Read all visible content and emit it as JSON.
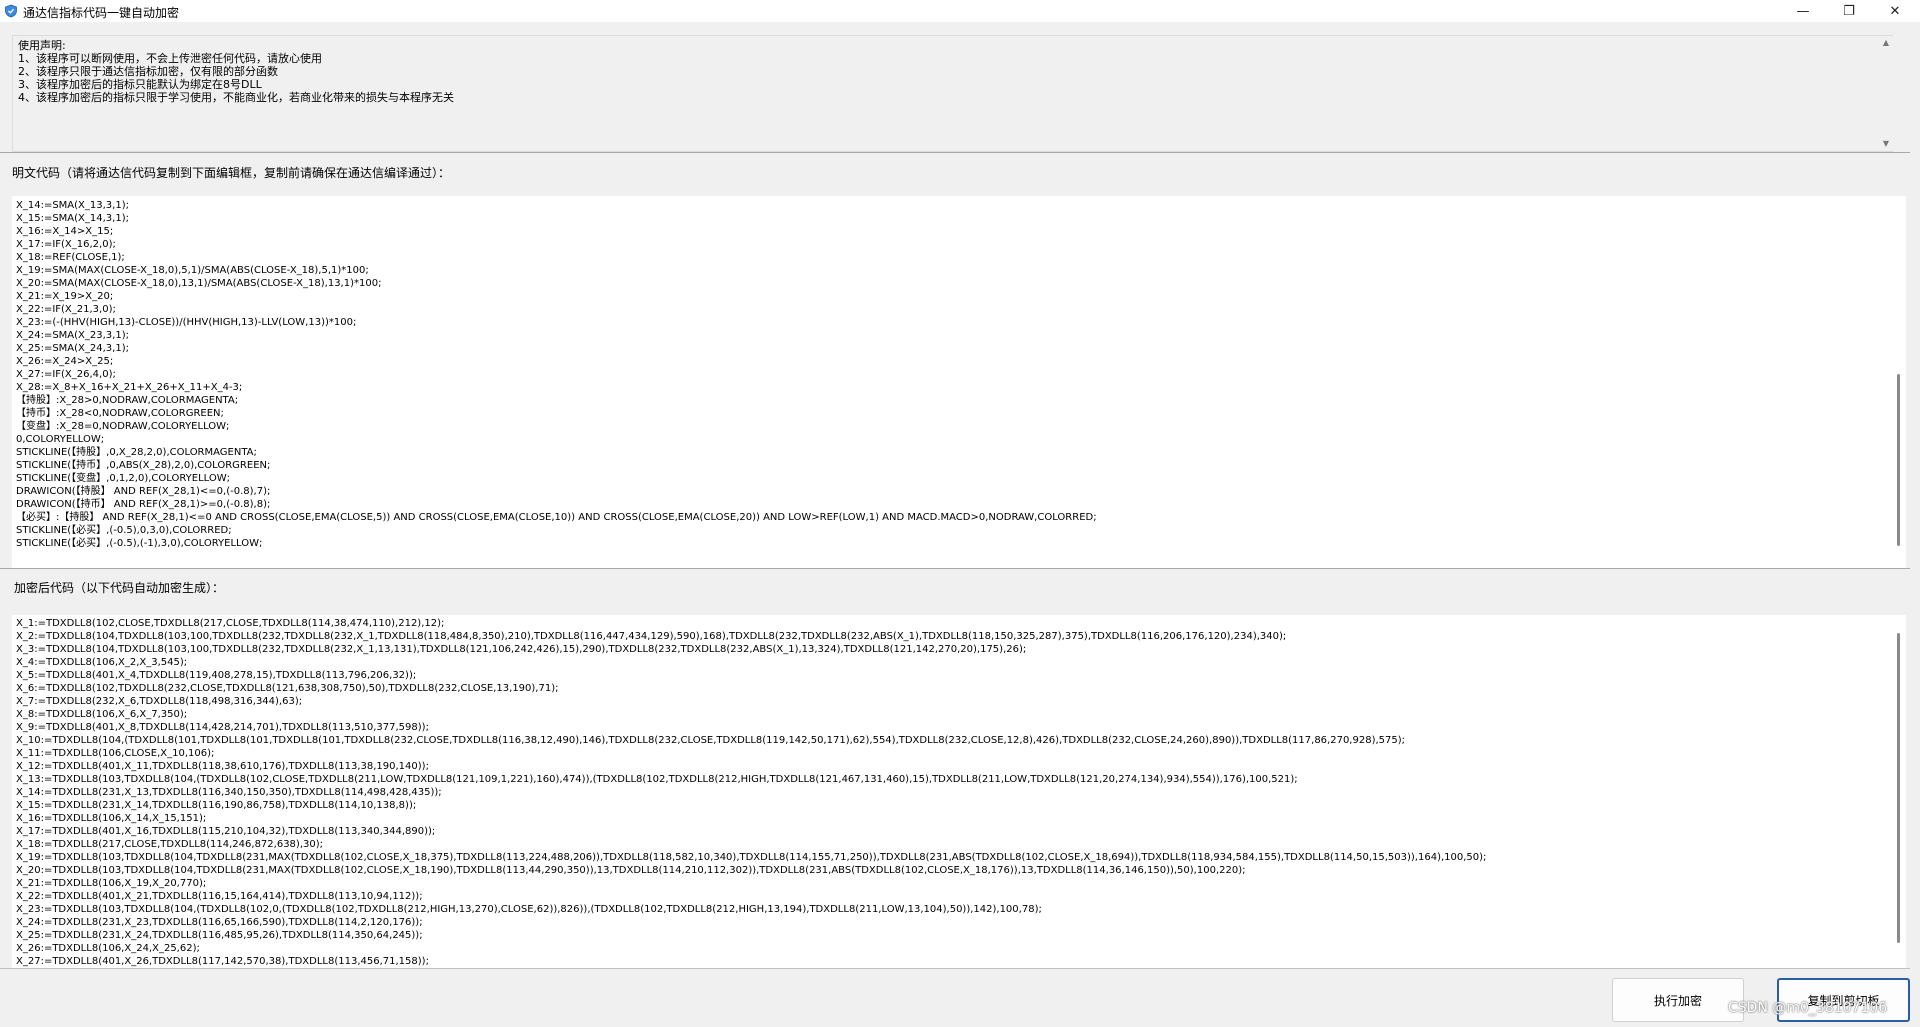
{
  "window": {
    "title": "通达信指标代码一键自动加密",
    "minimize_glyph": "—",
    "maximize_glyph": "❐",
    "close_glyph": "✕"
  },
  "disclaimer": {
    "lines": [
      "使用声明:",
      "1、该程序可以断网使用，不会上传泄密任何代码，请放心使用",
      "2、该程序只限于通达信指标加密，仅有限的部分函数",
      "3、该程序加密后的指标只能默认为绑定在8号DLL",
      "4、该程序加密后的指标只限于学习使用，不能商业化，若商业化带来的损失与本程序无关"
    ]
  },
  "plain_label": "明文代码（请将通达信代码复制到下面编辑框，复制前请确保在通达信编译通过）：",
  "plain_code": [
    "X_14:=SMA(X_13,3,1);",
    "X_15:=SMA(X_14,3,1);",
    "X_16:=X_14>X_15;",
    "X_17:=IF(X_16,2,0);",
    "X_18:=REF(CLOSE,1);",
    "X_19:=SMA(MAX(CLOSE-X_18,0),5,1)/SMA(ABS(CLOSE-X_18),5,1)*100;",
    "X_20:=SMA(MAX(CLOSE-X_18,0),13,1)/SMA(ABS(CLOSE-X_18),13,1)*100;",
    "X_21:=X_19>X_20;",
    "X_22:=IF(X_21,3,0);",
    "X_23:=(-(HHV(HIGH,13)-CLOSE))/(HHV(HIGH,13)-LLV(LOW,13))*100;",
    "X_24:=SMA(X_23,3,1);",
    "X_25:=SMA(X_24,3,1);",
    "X_26:=X_24>X_25;",
    "X_27:=IF(X_26,4,0);",
    "X_28:=X_8+X_16+X_21+X_26+X_11+X_4-3;",
    "【持股】:X_28>0,NODRAW,COLORMAGENTA;",
    "【持币】:X_28<0,NODRAW,COLORGREEN;",
    "【变盘】:X_28=0,NODRAW,COLORYELLOW;",
    "0,COLORYELLOW;",
    "STICKLINE(【持股】,0,X_28,2,0),COLORMAGENTA;",
    "STICKLINE(【持币】,0,ABS(X_28),2,0),COLORGREEN;",
    "STICKLINE(【变盘】,0,1,2,0),COLORYELLOW;",
    "DRAWICON(【持股】 AND REF(X_28,1)<=0,(-0.8),7);",
    "DRAWICON(【持币】 AND REF(X_28,1)>=0,(-0.8),8);",
    "【必买】:【持股】 AND REF(X_28,1)<=0 AND CROSS(CLOSE,EMA(CLOSE,5)) AND CROSS(CLOSE,EMA(CLOSE,10)) AND CROSS(CLOSE,EMA(CLOSE,20)) AND LOW>REF(LOW,1) AND MACD.MACD>0,NODRAW,COLORRED;",
    "STICKLINE(【必买】,(-0.5),0,3,0),COLORRED;",
    "STICKLINE(【必买】,(-0.5),(-1),3,0),COLORYELLOW;"
  ],
  "encrypted_label": "加密后代码（以下代码自动加密生成）：",
  "encrypted_code": [
    "X_1:=TDXDLL8(102,CLOSE,TDXDLL8(217,CLOSE,TDXDLL8(114,38,474,110),212),12);",
    "X_2:=TDXDLL8(104,TDXDLL8(103,100,TDXDLL8(232,TDXDLL8(232,X_1,TDXDLL8(118,484,8,350),210),TDXDLL8(116,447,434,129),590),168),TDXDLL8(232,TDXDLL8(232,ABS(X_1),TDXDLL8(118,150,325,287),375),TDXDLL8(116,206,176,120),234),340);",
    "X_3:=TDXDLL8(104,TDXDLL8(103,100,TDXDLL8(232,TDXDLL8(232,X_1,13,131),TDXDLL8(121,106,242,426),15),290),TDXDLL8(232,TDXDLL8(232,ABS(X_1),13,324),TDXDLL8(121,142,270,20),175),26);",
    "X_4:=TDXDLL8(106,X_2,X_3,545);",
    "X_5:=TDXDLL8(401,X_4,TDXDLL8(119,408,278,15),TDXDLL8(113,796,206,32));",
    "X_6:=TDXDLL8(102,TDXDLL8(232,CLOSE,TDXDLL8(121,638,308,750),50),TDXDLL8(232,CLOSE,13,190),71);",
    "X_7:=TDXDLL8(232,X_6,TDXDLL8(118,498,316,344),63);",
    "X_8:=TDXDLL8(106,X_6,X_7,350);",
    "X_9:=TDXDLL8(401,X_8,TDXDLL8(114,428,214,701),TDXDLL8(113,510,377,598));",
    "X_10:=TDXDLL8(104,(TDXDLL8(101,TDXDLL8(101,TDXDLL8(101,TDXDLL8(232,CLOSE,TDXDLL8(116,38,12,490),146),TDXDLL8(232,CLOSE,TDXDLL8(119,142,50,171),62),554),TDXDLL8(232,CLOSE,12,8),426),TDXDLL8(232,CLOSE,24,260),890)),TDXDLL8(117,86,270,928),575);",
    "X_11:=TDXDLL8(106,CLOSE,X_10,106);",
    "X_12:=TDXDLL8(401,X_11,TDXDLL8(118,38,610,176),TDXDLL8(113,38,190,140));",
    "X_13:=TDXDLL8(103,TDXDLL8(104,(TDXDLL8(102,CLOSE,TDXDLL8(211,LOW,TDXDLL8(121,109,1,221),160),474)),(TDXDLL8(102,TDXDLL8(212,HIGH,TDXDLL8(121,467,131,460),15),TDXDLL8(211,LOW,TDXDLL8(121,20,274,134),934),554)),176),100,521);",
    "X_14:=TDXDLL8(231,X_13,TDXDLL8(116,340,150,350),TDXDLL8(114,498,428,435));",
    "X_15:=TDXDLL8(231,X_14,TDXDLL8(116,190,86,758),TDXDLL8(114,10,138,8));",
    "X_16:=TDXDLL8(106,X_14,X_15,151);",
    "X_17:=TDXDLL8(401,X_16,TDXDLL8(115,210,104,32),TDXDLL8(113,340,344,890));",
    "X_18:=TDXDLL8(217,CLOSE,TDXDLL8(114,246,872,638),30);",
    "X_19:=TDXDLL8(103,TDXDLL8(104,TDXDLL8(231,MAX(TDXDLL8(102,CLOSE,X_18,375),TDXDLL8(113,224,488,206)),TDXDLL8(118,582,10,340),TDXDLL8(114,155,71,250)),TDXDLL8(231,ABS(TDXDLL8(102,CLOSE,X_18,694)),TDXDLL8(118,934,584,155),TDXDLL8(114,50,15,503)),164),100,50);",
    "X_20:=TDXDLL8(103,TDXDLL8(104,TDXDLL8(231,MAX(TDXDLL8(102,CLOSE,X_18,190),TDXDLL8(113,44,290,350)),13,TDXDLL8(114,210,112,302)),TDXDLL8(231,ABS(TDXDLL8(102,CLOSE,X_18,176)),13,TDXDLL8(114,36,146,150)),50),100,220);",
    "X_21:=TDXDLL8(106,X_19,X_20,770);",
    "X_22:=TDXDLL8(401,X_21,TDXDLL8(116,15,164,414),TDXDLL8(113,10,94,112));",
    "X_23:=TDXDLL8(103,TDXDLL8(104,(TDXDLL8(102,0,(TDXDLL8(102,TDXDLL8(212,HIGH,13,270),CLOSE,62)),826)),(TDXDLL8(102,TDXDLL8(212,HIGH,13,194),TDXDLL8(211,LOW,13,104),50)),142),100,78);",
    "X_24:=TDXDLL8(231,X_23,TDXDLL8(116,65,166,590),TDXDLL8(114,2,120,176));",
    "X_25:=TDXDLL8(231,X_24,TDXDLL8(116,485,95,26),TDXDLL8(114,350,64,245));",
    "X_26:=TDXDLL8(106,X_24,X_25,62);",
    "X_27:=TDXDLL8(401,X_26,TDXDLL8(117,142,570,38),TDXDLL8(113,456,71,158));"
  ],
  "buttons": {
    "encrypt": "执行加密",
    "copy": "复制到剪切板"
  },
  "watermark": "CSDN @m0_38107106",
  "colors": {
    "window_bg": "#f0f0f0",
    "editor_bg": "#ffffff",
    "primary_border": "#2a5fa6"
  }
}
